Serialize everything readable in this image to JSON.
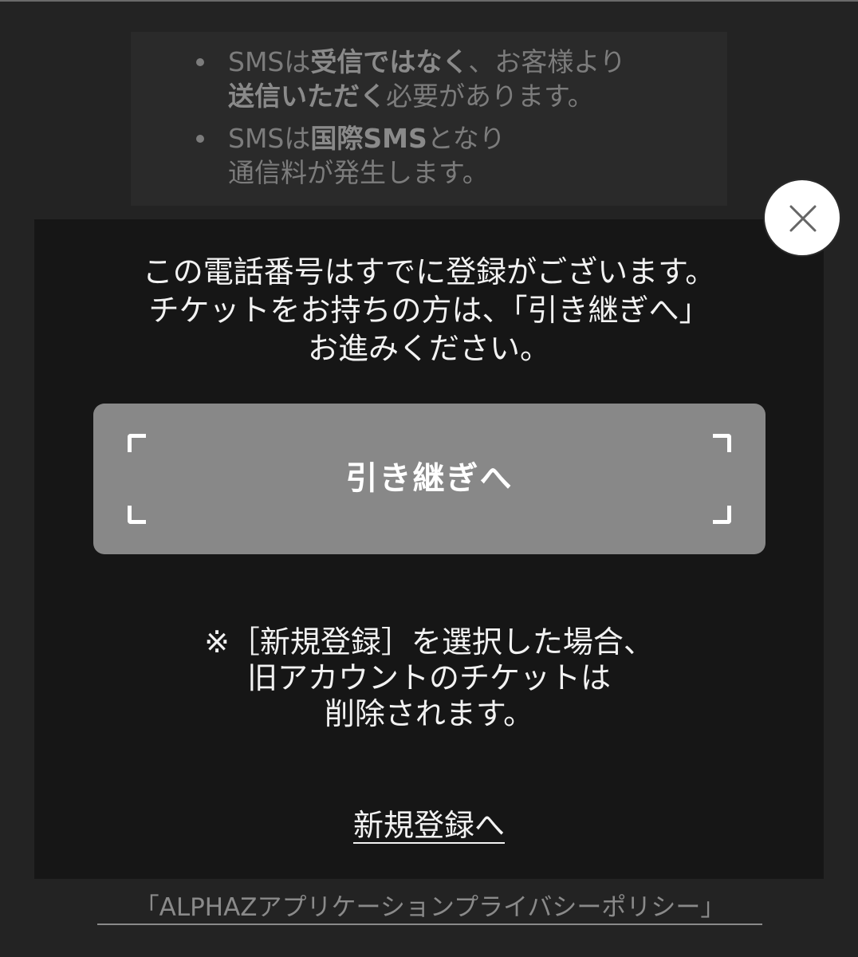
{
  "notices": [
    {
      "line1": [
        {
          "text": "SMSは",
          "bold": false
        },
        {
          "text": "受信ではなく",
          "bold": true
        },
        {
          "text": "、お客様より",
          "bold": false
        }
      ],
      "line2": [
        {
          "text": "送信いただく",
          "bold": true
        },
        {
          "text": "必要があります。",
          "bold": false
        }
      ]
    },
    {
      "line1": [
        {
          "text": "SMSは",
          "bold": false
        },
        {
          "text": "国際SMS",
          "bold": true
        },
        {
          "text": "となり",
          "bold": false
        }
      ],
      "line2": [
        {
          "text": "通信料が発生します。",
          "bold": false
        }
      ]
    }
  ],
  "modal": {
    "message_lines": [
      "この電話番号はすでに登録がございます。",
      "チケットをお持ちの方は、「引き継ぎへ」",
      "お進みください。"
    ],
    "transfer_button_label": "引き継ぎへ",
    "warning_lines": [
      "※［新規登録］を選択した場合、",
      "旧アカウントのチケットは",
      "削除されます。"
    ],
    "new_register_link": "新規登録へ",
    "close_icon": "close-icon"
  },
  "footer": {
    "privacy_link": "「ALPHAZアプリケーションプライバシーポリシー」"
  },
  "colors": {
    "page_bg": "#232323",
    "modal_bg": "#161616",
    "button_bg": "#888888",
    "text_primary": "#f2f2f2",
    "text_muted": "#7c7c7c"
  }
}
